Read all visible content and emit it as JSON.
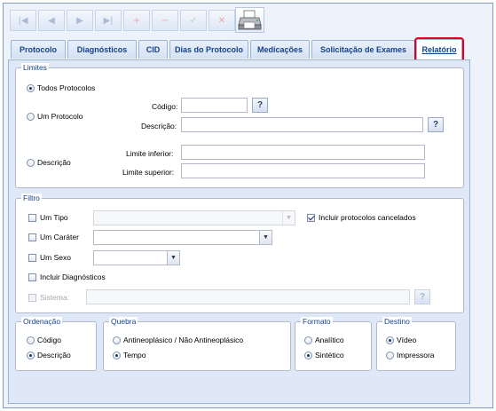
{
  "toolbar": {
    "buttons": [
      {
        "name": "first-record-button",
        "icon": "first-icon",
        "glyph": "|◀"
      },
      {
        "name": "previous-record-button",
        "icon": "previous-icon",
        "glyph": "◀"
      },
      {
        "name": "next-record-button",
        "icon": "next-icon",
        "glyph": "▶"
      },
      {
        "name": "last-record-button",
        "icon": "last-icon",
        "glyph": "▶|"
      },
      {
        "name": "add-button",
        "icon": "plus-icon",
        "glyph": "+"
      },
      {
        "name": "remove-button",
        "icon": "minus-icon",
        "glyph": "−"
      },
      {
        "name": "confirm-button",
        "icon": "check-icon",
        "glyph": "✓"
      },
      {
        "name": "cancel-button",
        "icon": "close-icon",
        "glyph": "✕"
      }
    ],
    "print_icon": "printer-icon"
  },
  "tabs": [
    {
      "label": "Protocolo",
      "active": false
    },
    {
      "label": "Diagnósticos",
      "active": false
    },
    {
      "label": "CID",
      "active": false
    },
    {
      "label": "Dias do Protocolo",
      "active": false
    },
    {
      "label": "Medicações",
      "active": false
    },
    {
      "label": "Solicitação de Exames",
      "active": false
    },
    {
      "label": "Relatório",
      "active": true
    }
  ],
  "limites": {
    "legend": "Limites",
    "todos_protocolos": "Todos Protocolos",
    "um_protocolo": "Um Protocolo",
    "descricao_option": "Descrição",
    "codigo_label": "Código:",
    "codigo_value": "",
    "descricao_label": "Descrição:",
    "descricao_value": "",
    "limite_inferior_label": "Limite inferior:",
    "limite_inferior_value": "",
    "limite_superior_label": "Limite superior:",
    "limite_superior_value": "",
    "help_glyph": "?",
    "selected": "Todos Protocolos"
  },
  "filtro": {
    "legend": "Filtro",
    "um_tipo": "Um Tipo",
    "tipo_value": "",
    "incluir_cancelados": "Incluir protocolos cancelados",
    "incluir_cancelados_checked": true,
    "um_carater": "Um Caráter",
    "carater_value": "",
    "um_sexo": "Um Sexo",
    "sexo_value": "",
    "incluir_diagnosticos": "Incluir Diagnósticos",
    "sistema_label": "Sistema:",
    "sistema_value": "",
    "help_glyph": "?",
    "arrow_glyph": "▼"
  },
  "ordenacao": {
    "legend": "Ordenação",
    "options": [
      "Código",
      "Descrição"
    ],
    "selected": "Descrição"
  },
  "quebra": {
    "legend": "Quebra",
    "options": [
      "Antineoplásico / Não Antineoplásico",
      "Tempo"
    ],
    "selected": "Tempo"
  },
  "formato": {
    "legend": "Formato",
    "options": [
      "Analítico",
      "Sintético"
    ],
    "selected": "Sintético"
  },
  "destino": {
    "legend": "Destino",
    "options": [
      "Vídeo",
      "Impressora"
    ],
    "selected": "Vídeo"
  },
  "colors": {
    "accent": "#15428b",
    "highlight_border": "#e0001b",
    "panel_bg": "#dfe8f6"
  }
}
